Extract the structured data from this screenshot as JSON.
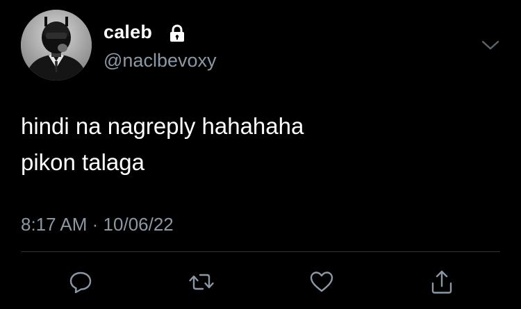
{
  "author": {
    "display_name": "caleb",
    "handle": "@naclbevoxy",
    "protected_account": true
  },
  "tweet": {
    "lines": [
      "hindi na nagreply hahahaha",
      "pikon talaga"
    ],
    "time": "8:17 AM",
    "separator": "·",
    "date": "10/06/22"
  },
  "actions": [
    {
      "name": "reply",
      "icon": "reply-icon"
    },
    {
      "name": "retweet",
      "icon": "retweet-icon"
    },
    {
      "name": "like",
      "icon": "heart-icon"
    },
    {
      "name": "share",
      "icon": "share-icon"
    }
  ],
  "colors": {
    "background": "#000000",
    "text": "#ffffff",
    "secondary_text": "#8b98a5",
    "divider": "#2f3336",
    "icon": "#8b98a5"
  }
}
